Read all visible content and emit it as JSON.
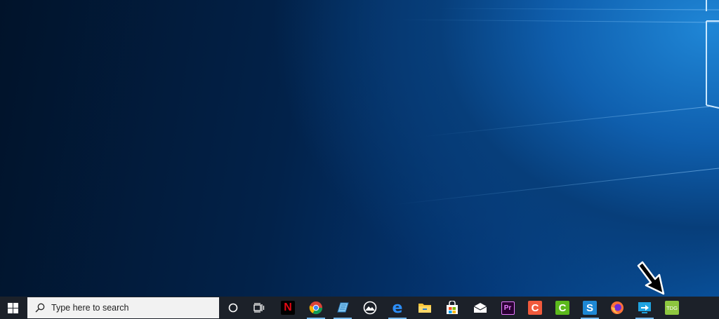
{
  "desktop": {
    "wallpaper": "windows-10-light-beam",
    "accent_colors": [
      "#01132a",
      "#04397a",
      "#1f86d6"
    ]
  },
  "taskbar": {
    "background": "#1c2129",
    "start_icon": "windows-logo-icon",
    "search_placeholder": "Type here to search",
    "pinned": [
      {
        "name": "cortana-icon",
        "running": false
      },
      {
        "name": "task-view-icon",
        "running": false
      },
      {
        "name": "netflix-icon",
        "label": "N",
        "running": false
      },
      {
        "name": "chrome-icon",
        "running": true
      },
      {
        "name": "notepad-icon",
        "running": true
      },
      {
        "name": "photos-icon",
        "running": false
      },
      {
        "name": "edge-icon",
        "label": "e",
        "running": true
      },
      {
        "name": "file-explorer-icon",
        "running": false
      },
      {
        "name": "store-icon",
        "running": false
      },
      {
        "name": "mail-icon",
        "running": false
      },
      {
        "name": "premiere-icon",
        "label": "Pr",
        "running": false
      },
      {
        "name": "camtasia-icon",
        "label": "C",
        "running": false
      },
      {
        "name": "camtasia-green-icon",
        "label": "C",
        "running": false
      },
      {
        "name": "snagit-icon",
        "label": "S",
        "running": true
      },
      {
        "name": "firefox-icon",
        "running": false
      },
      {
        "name": "remote-desktop-icon",
        "running": true
      },
      {
        "name": "tdg-icon",
        "label": "TDG",
        "running": false
      }
    ]
  },
  "cursor": {
    "icon": "arrow-pointer-icon"
  }
}
